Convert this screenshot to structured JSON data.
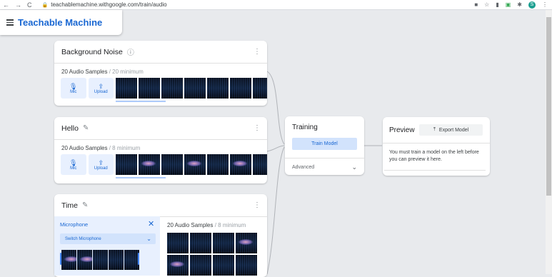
{
  "browser": {
    "url": "teachablemachine.withgoogle.com/train/audio",
    "nav": [
      "←",
      "→",
      "C"
    ],
    "avatar_letter": "S"
  },
  "app": {
    "title": "Teachable Machine"
  },
  "classes": [
    {
      "name": "Background Noise",
      "samples_count": "20 Audio Samples",
      "samples_min": "/ 20 minimum",
      "mic_label": "Mic",
      "upload_label": "Upload",
      "title_icon": "help-icon"
    },
    {
      "name": "Hello",
      "samples_count": "20 Audio Samples",
      "samples_min": "/ 8 minimum",
      "mic_label": "Mic",
      "upload_label": "Upload",
      "title_icon": "edit-icon"
    },
    {
      "name": "Time",
      "samples_count": "20 Audio Samples",
      "samples_min": "/ 8 minimum",
      "title_icon": "edit-icon"
    }
  ],
  "microphone": {
    "title": "Microphone",
    "switch_label": "Switch Microphone"
  },
  "training": {
    "title": "Training",
    "train_button": "Train Model",
    "advanced_label": "Advanced"
  },
  "preview": {
    "title": "Preview",
    "export_button": "Export Model",
    "message": "You must train a model on the left before you can preview it here."
  },
  "colors": {
    "brand": "#1967d2",
    "button_bg": "#e8f0fe",
    "page_bg": "#e8eaed"
  }
}
